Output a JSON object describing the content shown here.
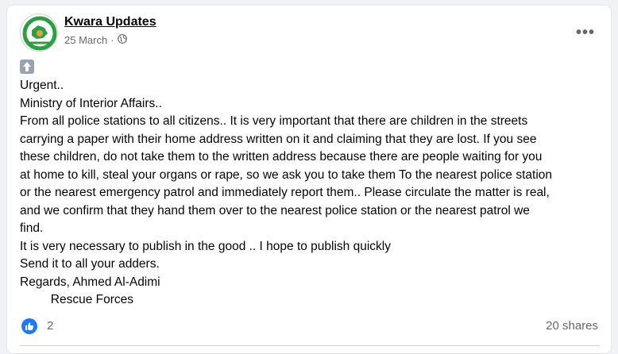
{
  "post": {
    "author": "Kwara Updates",
    "date": "25 March",
    "separator": "·",
    "privacy_icon": "globe-icon",
    "more_label": "•••",
    "body_icon": "up-arrow-icon",
    "text": "Urgent..\nMinistry of Interior Affairs..\nFrom all police stations to all citizens.. It is very important that there are children in the streets\ncarrying a paper with their home address written on it and claiming that they are lost. If you see\nthese children, do not take them to the written address because there are people waiting for you\nat home to kill, steal your organs or rape, so we ask you to take them To the nearest police station\nor the nearest emergency patrol and immediately report them.. Please circulate the matter is real,\nand we confirm that they hand them over to the nearest police station or the nearest patrol we\nfind.\nIt is very necessary to publish in the good .. I hope to publish quickly\nSend it to all your adders.\nRegards, Ahmed Al-Adimi\n         Rescue Forces",
    "reactions": {
      "icon": "thumbs-up-icon",
      "count": "2"
    },
    "shares": "20 shares"
  },
  "colors": {
    "like_blue": "#2078f4",
    "secondary_text": "#65676b",
    "avatar_green": "#2e9e44"
  }
}
